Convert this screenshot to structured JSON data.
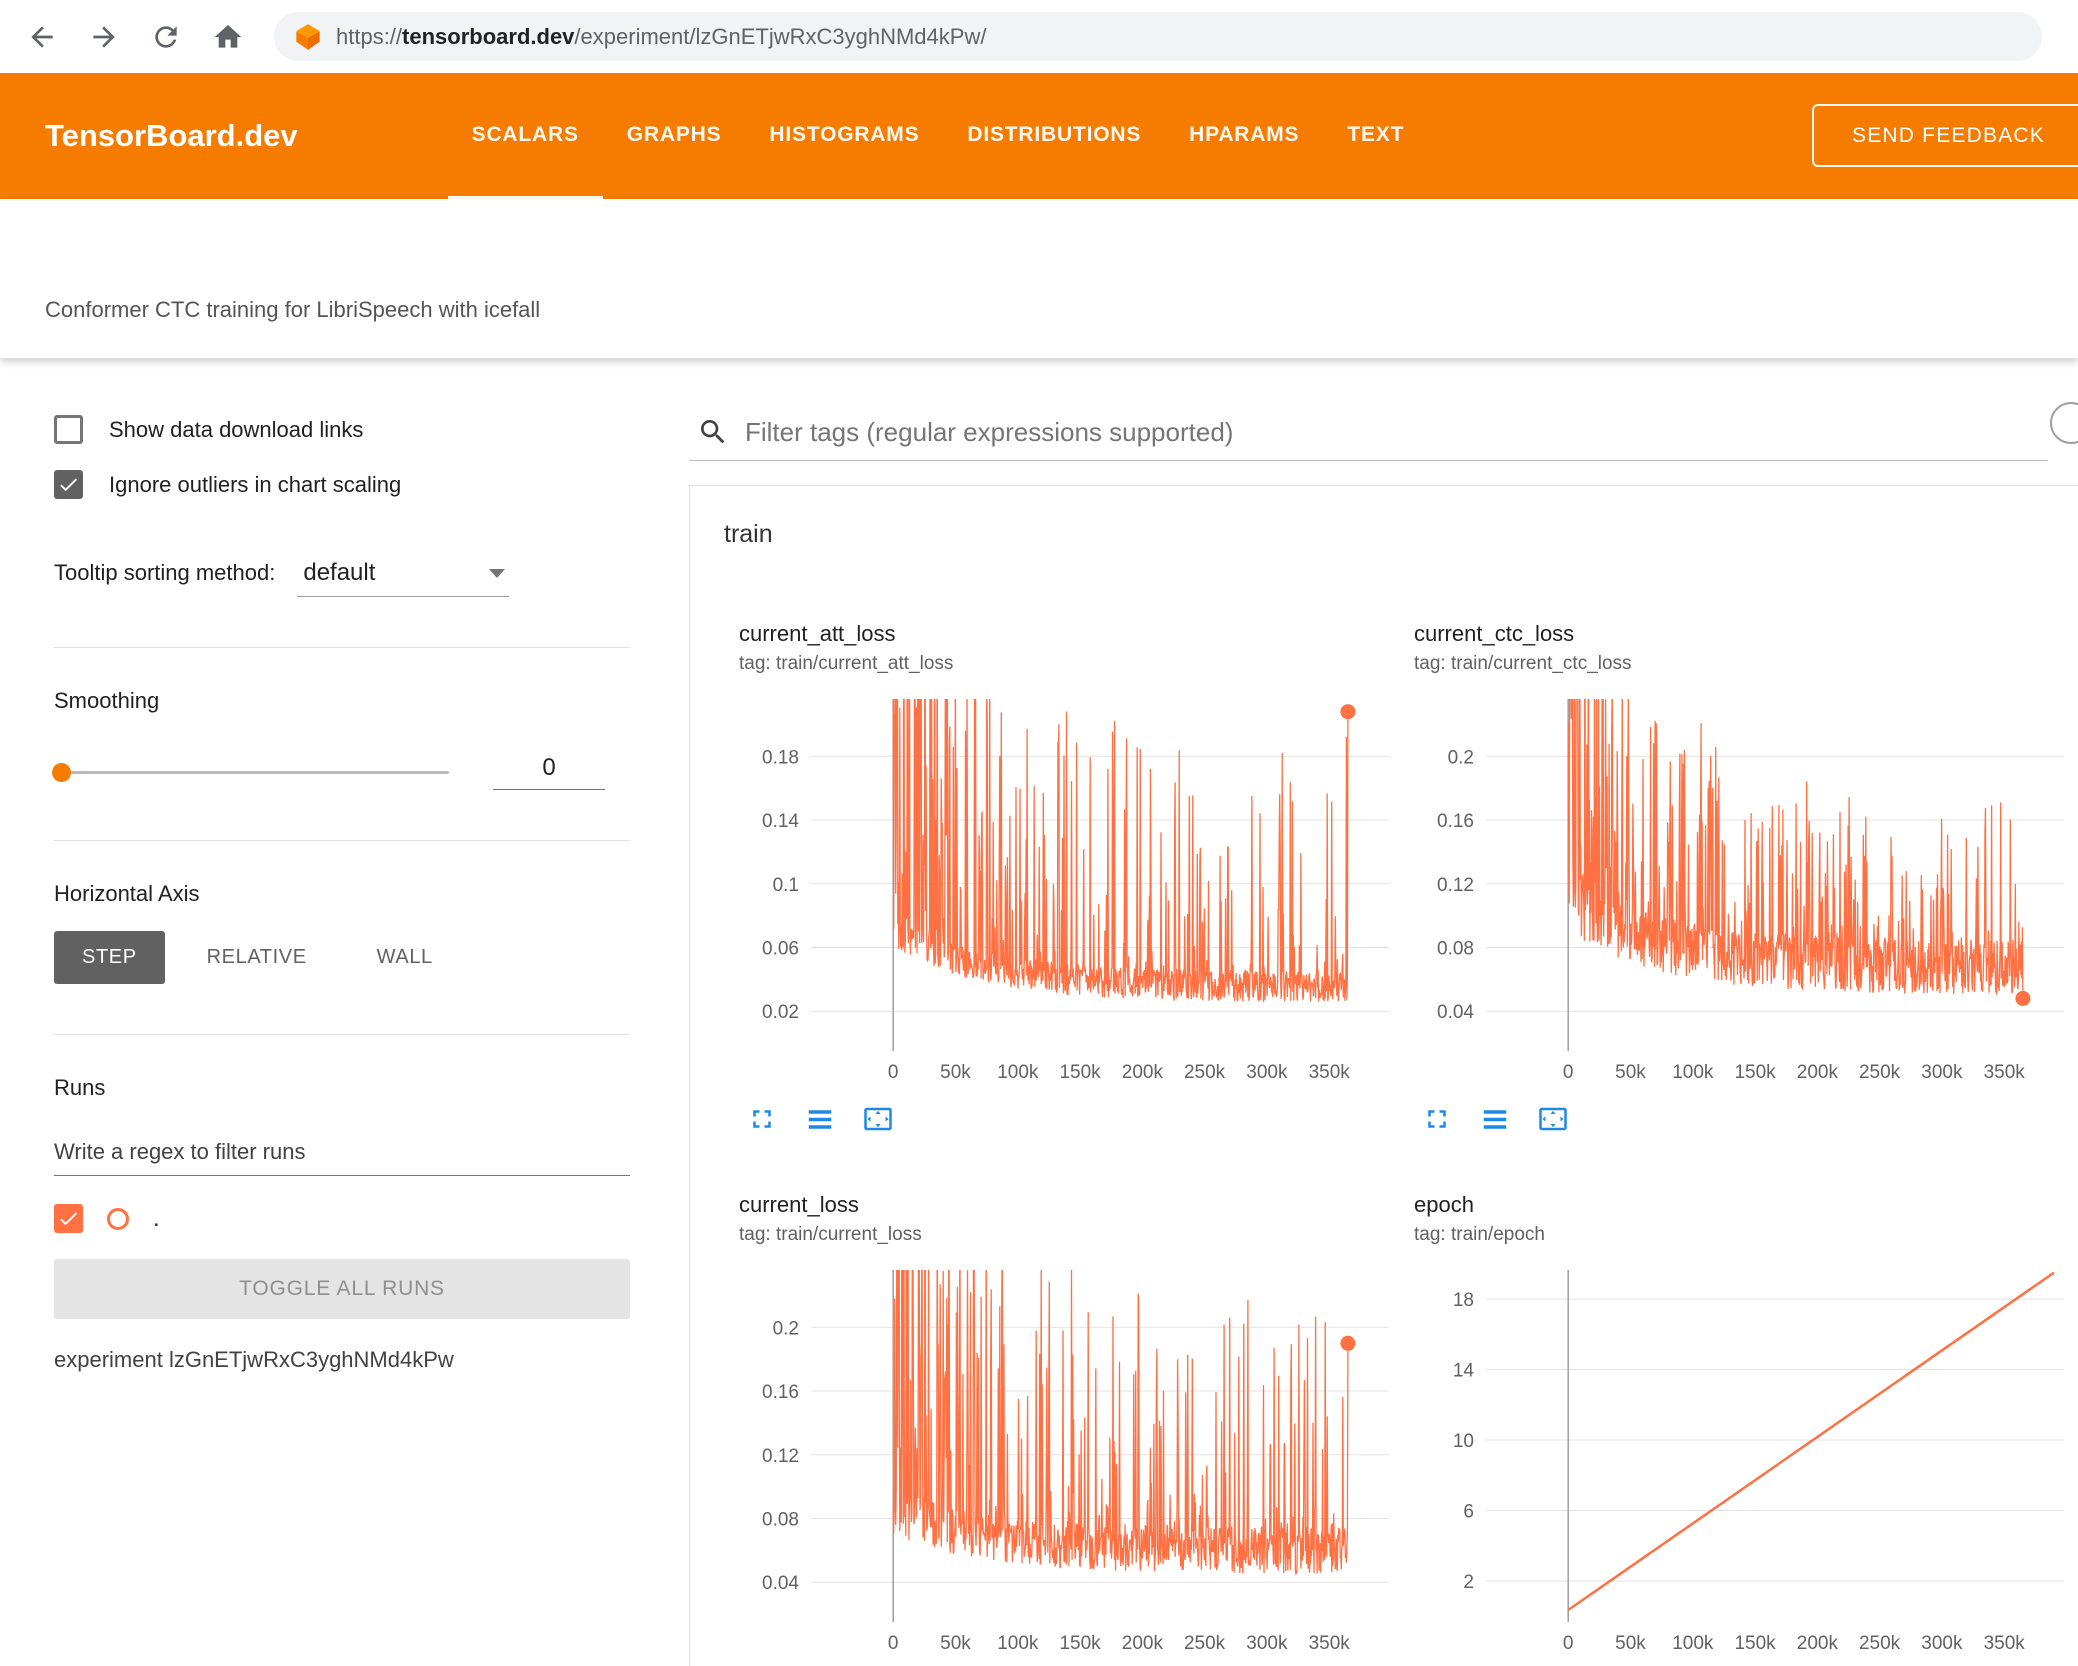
{
  "browser": {
    "url_scheme": "https://",
    "url_domain": "tensorboard.dev",
    "url_path": "/experiment/lzGnETjwRxC3yghNMd4kPw/"
  },
  "header": {
    "logo": "TensorBoard.dev",
    "tabs": [
      {
        "label": "SCALARS",
        "active": true
      },
      {
        "label": "GRAPHS",
        "active": false
      },
      {
        "label": "HISTOGRAMS",
        "active": false
      },
      {
        "label": "DISTRIBUTIONS",
        "active": false
      },
      {
        "label": "HPARAMS",
        "active": false
      },
      {
        "label": "TEXT",
        "active": false
      }
    ],
    "feedback_button": "SEND FEEDBACK"
  },
  "experiment": {
    "title": "Conformer CTC training for LibriSpeech with icefall"
  },
  "sidebar": {
    "show_download": {
      "label": "Show data download links",
      "checked": false
    },
    "ignore_outliers": {
      "label": "Ignore outliers in chart scaling",
      "checked": true
    },
    "tooltip_sorting": {
      "label": "Tooltip sorting method:",
      "value": "default"
    },
    "smoothing": {
      "label": "Smoothing",
      "value": "0"
    },
    "horizontal_axis": {
      "label": "Horizontal Axis",
      "options": [
        "STEP",
        "RELATIVE",
        "WALL"
      ],
      "selected": "STEP"
    },
    "runs": {
      "label": "Runs",
      "filter_placeholder": "Write a regex to filter runs",
      "run_item": ".",
      "run_checked": true,
      "toggle_all": "TOGGLE ALL RUNS",
      "experiment_label": "experiment lzGnETjwRxC3yghNMd4kPw"
    }
  },
  "main": {
    "filter_placeholder": "Filter tags (regular expressions supported)",
    "section": "train"
  },
  "colors": {
    "header_orange": "#f57c00",
    "run_color": "#ff7043",
    "toolbar_icon_blue": "#1e88e5",
    "gridline": "#e3e3e3",
    "axis_line": "#9e9e9e"
  },
  "chart_data": [
    {
      "id": "current_att_loss",
      "type": "line",
      "title": "current_att_loss",
      "tag": "tag: train/current_att_loss",
      "run": "train",
      "y_ticks": [
        0.02,
        0.06,
        0.1,
        0.14,
        0.18
      ],
      "x_tick_labels": [
        "0",
        "50k",
        "100k",
        "150k",
        "200k",
        "250k",
        "300k",
        "350k"
      ],
      "x_tick_step": 50000,
      "x_view": [
        -66000,
        398000
      ],
      "y_view": [
        -0.005,
        0.216
      ],
      "x_data_end": 365000,
      "summary": "Noisy attention loss over ~370k steps: dense spikes above 0.2 early, baseline decays from ~0.06 to ~0.02-0.03, frequent spikes up to ~0.2 throughout; final value 0.208",
      "gen": {
        "kind": "noisy-decay",
        "seed": 11,
        "n": 900,
        "base_start": 0.06,
        "base_end": 0.025,
        "decay": 5,
        "jitter": 0.02,
        "spike_prob": 0.2,
        "spike_amp": 0.155,
        "early_boost": 0.55,
        "early_amp": 0.25,
        "early_decay": 8,
        "end_value": 0.208
      },
      "end_dot": {
        "value": 0.208
      },
      "toolbar": true
    },
    {
      "id": "current_ctc_loss",
      "type": "line",
      "title": "current_ctc_loss",
      "tag": "tag: train/current_ctc_loss",
      "run": "train",
      "y_ticks": [
        0.04,
        0.08,
        0.12,
        0.16,
        0.2
      ],
      "x_tick_labels": [
        "0",
        "50k",
        "100k",
        "150k",
        "200k",
        "250k",
        "300k",
        "350k"
      ],
      "x_tick_step": 50000,
      "x_view": [
        -66000,
        398000
      ],
      "y_view": [
        0.015,
        0.236
      ],
      "x_data_end": 365000,
      "summary": "Noisy CTC loss over ~370k steps: early values clipped above 0.2, baseline decays from ~0.09 to ~0.05 with thick noise band and spikes to ~0.17; final value ~0.048",
      "gen": {
        "kind": "noisy-decay",
        "seed": 23,
        "n": 900,
        "base_start": 0.09,
        "base_end": 0.05,
        "decay": 5,
        "jitter": 0.035,
        "spike_prob": 0.25,
        "spike_amp": 0.1,
        "early_boost": 0.5,
        "early_amp": 0.18,
        "early_decay": 6,
        "end_value": 0.048
      },
      "end_dot": {
        "value": 0.048
      },
      "toolbar": true
    },
    {
      "id": "current_loss",
      "type": "line",
      "title": "current_loss",
      "tag": "tag: train/current_loss",
      "run": "train",
      "y_ticks": [
        0.04,
        0.08,
        0.12,
        0.16,
        0.2
      ],
      "x_tick_labels": [
        "0",
        "50k",
        "100k",
        "150k",
        "200k",
        "250k",
        "300k",
        "350k"
      ],
      "x_tick_step": 50000,
      "x_view": [
        -66000,
        398000
      ],
      "y_view": [
        0.015,
        0.236
      ],
      "x_data_end": 365000,
      "summary": "Noisy total loss over ~370k steps: dense early spikes above 0.2, baseline decays from ~0.07 to ~0.045, recurring spikes up to ~0.2; final value ~0.19",
      "gen": {
        "kind": "noisy-decay",
        "seed": 37,
        "n": 900,
        "base_start": 0.07,
        "base_end": 0.045,
        "decay": 5,
        "jitter": 0.03,
        "spike_prob": 0.22,
        "spike_amp": 0.15,
        "early_boost": 0.5,
        "early_amp": 0.25,
        "early_decay": 7,
        "end_value": 0.19
      },
      "end_dot": {
        "value": 0.19
      },
      "toolbar": false
    },
    {
      "id": "epoch",
      "type": "line",
      "title": "epoch",
      "tag": "tag: train/epoch",
      "run": "train",
      "y_ticks": [
        2,
        6,
        10,
        14,
        18
      ],
      "x_tick_labels": [
        "0",
        "50k",
        "100k",
        "150k",
        "200k",
        "250k",
        "300k",
        "350k"
      ],
      "x_tick_step": 50000,
      "x_view": [
        -66000,
        398000
      ],
      "y_view": [
        -0.33,
        19.65
      ],
      "x_data_end": 390000,
      "summary": "Epoch counter rising linearly from ~0 at step 0 to ~19.5 at step ~390k",
      "gen": {
        "kind": "linear",
        "seed": 1,
        "points": [
          [
            0,
            0.35
          ],
          [
            390000,
            19.5
          ]
        ]
      },
      "end_dot": null,
      "toolbar": false
    }
  ]
}
